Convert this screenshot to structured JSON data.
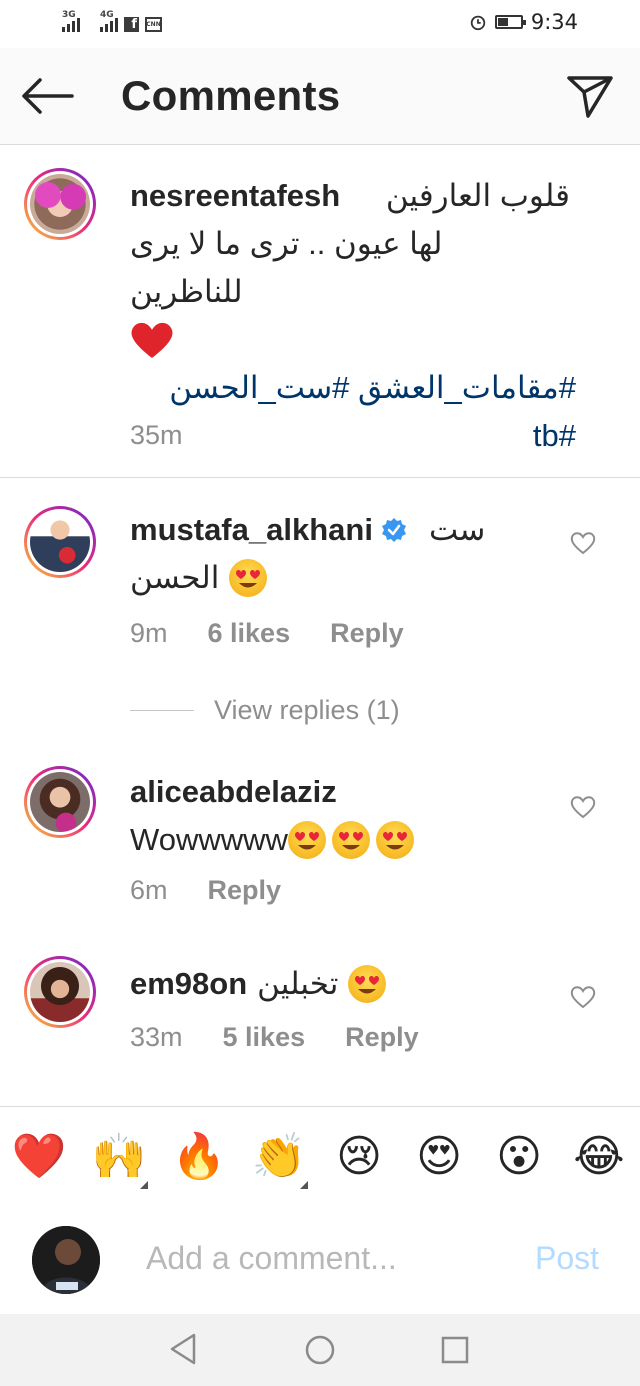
{
  "status_bar": {
    "network1": "3G",
    "network2": "4G",
    "time": "9:34",
    "battery_level": 0.45
  },
  "header": {
    "title": "Comments"
  },
  "comments": [
    {
      "username": "nesreentafesh",
      "text_line1": "قلوب العارفين",
      "text_line2": "لها عيون .. ترى ما لا يرى للناظرين",
      "emoji": "❤️",
      "hashtags_line1": "#مقامات_العشق #ست_الحسن",
      "hashtags_line2": "tb#",
      "time": "35m"
    },
    {
      "username": "mustafa_alkhani",
      "text_line1": "ست",
      "text_line2": "الحسن",
      "emoji": "😍",
      "time": "9m",
      "likes": "6 likes",
      "reply": "Reply",
      "view_replies": "View replies (1)"
    },
    {
      "username": "aliceabdelaziz",
      "text": "Wowwwww",
      "emojis": "😍😍😍",
      "time": "6m",
      "reply": "Reply"
    },
    {
      "username": "em98on",
      "text": "تخبلين",
      "emoji": "😍",
      "time": "33m",
      "likes": "5 likes",
      "reply": "Reply"
    }
  ],
  "reactions": [
    "❤️",
    "🙌",
    "🔥",
    "👏",
    "😢",
    "😍",
    "😮",
    "😂"
  ],
  "composer": {
    "placeholder": "Add a comment...",
    "post_label": "Post"
  },
  "colors": {
    "hashtag": "#003569",
    "verified": "#3897f0",
    "post_disabled": "#b3dbff"
  }
}
